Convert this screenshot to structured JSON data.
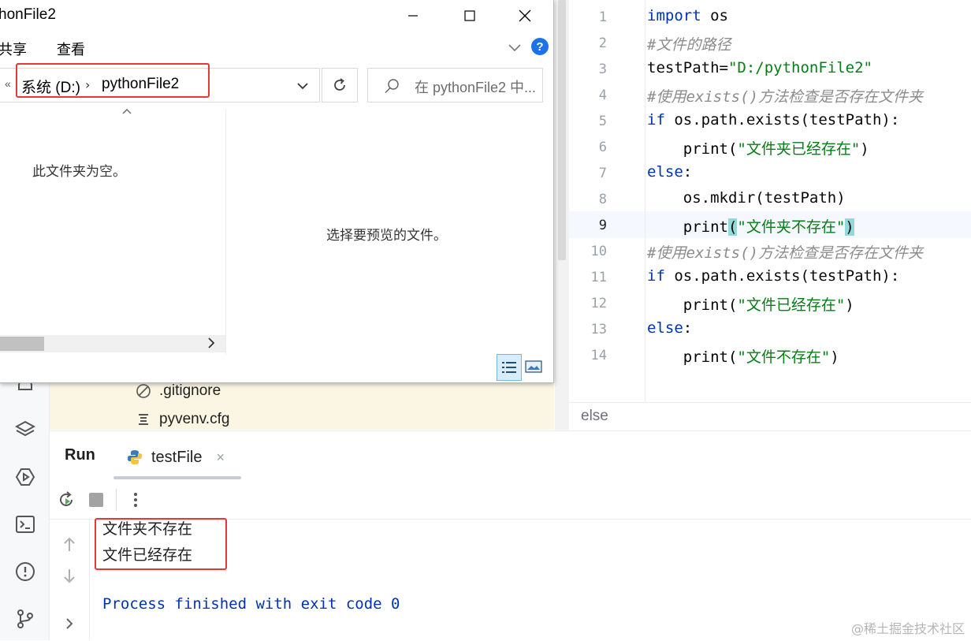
{
  "explorer": {
    "window_title": "honFile2",
    "ribbon_tabs": [
      "共享",
      "查看"
    ],
    "address": {
      "back_glyph": "«",
      "drive": "系统 (D:)",
      "folder": "pythonFile2",
      "separator": "›"
    },
    "search_placeholder": "在 pythonFile2 中...",
    "empty_message": "此文件夹为空。",
    "preview_message": "选择要预览的文件。",
    "help_label": "?"
  },
  "project": {
    "items": [
      {
        "name": ".gitignore",
        "icon": "ignore-icon"
      },
      {
        "name": "pyvenv.cfg",
        "icon": "config-file-icon"
      }
    ]
  },
  "editor": {
    "line_numbers": [
      "1",
      "2",
      "3",
      "4",
      "5",
      "6",
      "7",
      "8",
      "9",
      "10",
      "11",
      "12",
      "13",
      "14"
    ],
    "current_line": "9",
    "breadcrumb": "else",
    "code": {
      "l1_kw": "import",
      "l1_rest": " os",
      "l2": "#文件的路径",
      "l3_var": "testPath=",
      "l3_str": "\"D:/pythonFile2\"",
      "l4": "#使用exists()方法检查是否存在文件夹",
      "l5_kw": "if",
      "l5_rest": " os.path.exists(testPath):",
      "l6_fn": "    print(",
      "l6_str": "\"文件夹已经存在\"",
      "l6_end": ")",
      "l7_kw": "else",
      "l7_rest": ":",
      "l8": "    os.mkdir(testPath)",
      "l9_fn": "    print",
      "l9_open": "(",
      "l9_str": "\"文件夹不存在\"",
      "l9_close": ")",
      "l10": "#使用exists()方法检查是否存在文件夹",
      "l11_kw": "if",
      "l11_rest": " os.path.exists(testPath):",
      "l12_fn": "    print(",
      "l12_str": "\"文件已经存在\"",
      "l12_end": ")",
      "l13_kw": "else",
      "l13_rest": ":",
      "l14_fn": "    print(",
      "l14_str": "\"文件不存在\"",
      "l14_end": ")"
    }
  },
  "run": {
    "title": "Run",
    "tab_label": "testFile",
    "tab_close": "×",
    "output_lines": [
      "文件夹不存在",
      "文件已经存在"
    ],
    "process_line": "Process finished with exit code 0"
  },
  "watermark": "@稀土掘金技术社区",
  "colors": {
    "highlight_box": "#e53935",
    "keyword": "#0033b3",
    "string": "#067d17",
    "comment": "#8c8c8c"
  }
}
